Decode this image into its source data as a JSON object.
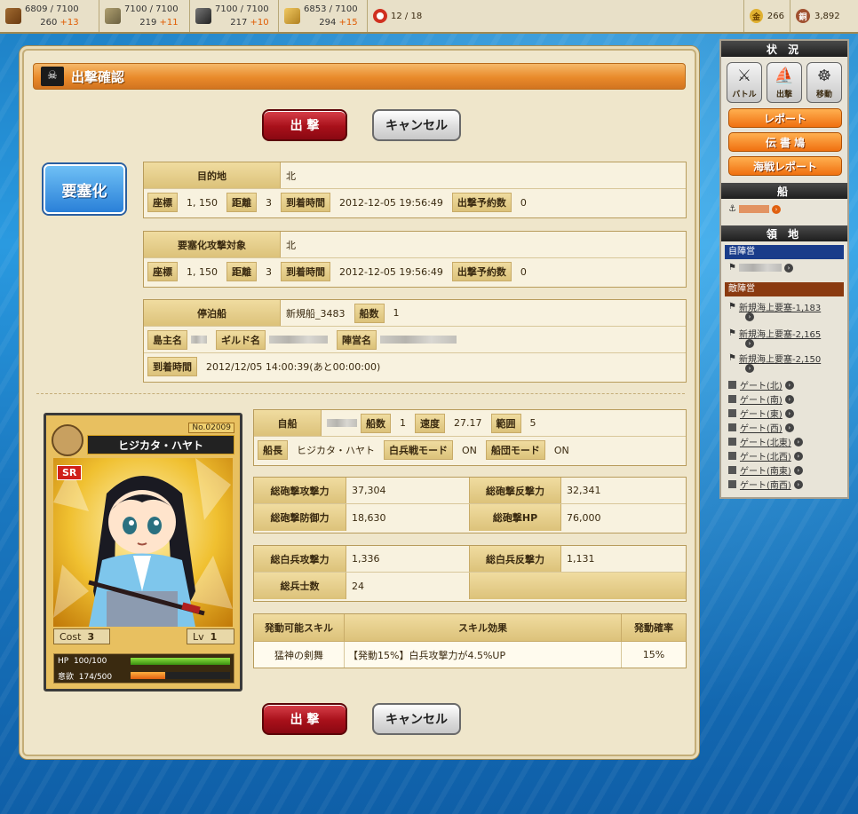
{
  "resources": [
    {
      "icon": "wood-icon",
      "color": "#8a5a2a",
      "amount": "6809 / 7100",
      "rate": "260",
      "inc": "+13"
    },
    {
      "icon": "cloth-icon",
      "color": "#7a7a4a",
      "amount": "7100 / 7100",
      "rate": "219",
      "inc": "+11"
    },
    {
      "icon": "iron-icon",
      "color": "#4a4a4a",
      "amount": "7100 / 7100",
      "rate": "217",
      "inc": "+10"
    },
    {
      "icon": "grain-icon",
      "color": "#d0a040",
      "amount": "6853 / 7100",
      "rate": "294",
      "inc": "+15"
    }
  ],
  "crew": "12 / 18",
  "gold": {
    "label": "金",
    "value": "266"
  },
  "copper": {
    "label": "銅",
    "value": "3,892"
  },
  "panel": {
    "title": "出撃確認",
    "sortie": "出 撃",
    "cancel": "キャンセル",
    "fortify": "要塞化"
  },
  "dest": {
    "label": "目的地",
    "value": "北",
    "coord_label": "座標",
    "coord": "1, 150",
    "dist_label": "距離",
    "dist": "3",
    "arrival_label": "到着時間",
    "arrival": "2012-12-05 19:56:49",
    "reserve_label": "出撃予約数",
    "reserve": "0"
  },
  "target": {
    "label": "要塞化攻撃対象",
    "value": "北",
    "coord_label": "座標",
    "coord": "1, 150",
    "dist_label": "距離",
    "dist": "3",
    "arrival_label": "到着時間",
    "arrival": "2012-12-05 19:56:49",
    "reserve_label": "出撃予約数",
    "reserve": "0"
  },
  "port": {
    "label": "停泊船",
    "value": "新規船_3483",
    "ships_label": "船数",
    "ships": "1",
    "owner_label": "島主名",
    "guild_label": "ギルド名",
    "camp_label": "陣営名",
    "arrival_label": "到着時間",
    "arrival": "2012/12/05 14:00:39(あと00:00:00)"
  },
  "card": {
    "no": "No.02009",
    "name": "ヒジカタ・ハヤト",
    "rarity": "SR",
    "cost_label": "Cost",
    "cost": "3",
    "lv_label": "Lv",
    "lv": "1",
    "hp_label": "HP",
    "hp": "100/100",
    "hp_pct": 100,
    "morale_label": "意欲",
    "morale": "174/500",
    "morale_pct": 34.8
  },
  "ship": {
    "label": "自船",
    "ships_label": "船数",
    "ships": "1",
    "speed_label": "速度",
    "speed": "27.17",
    "range_label": "範囲",
    "range": "5",
    "captain_label": "船長",
    "captain": "ヒジカタ・ハヤト",
    "melee_label": "白兵戦モード",
    "melee": "ON",
    "fleet_label": "船団モード",
    "fleet": "ON"
  },
  "cannon": {
    "atk_label": "総砲撃攻撃力",
    "atk": "37,304",
    "cnt_label": "総砲撃反撃力",
    "cnt": "32,341",
    "def_label": "総砲撃防御力",
    "def": "18,630",
    "hp_label": "総砲撃HP",
    "hp": "76,000"
  },
  "melee": {
    "atk_label": "総白兵攻撃力",
    "atk": "1,336",
    "cnt_label": "総白兵反撃力",
    "cnt": "1,131",
    "sol_label": "総兵士数",
    "sol": "24"
  },
  "skill": {
    "h1": "発動可能スキル",
    "h2": "スキル効果",
    "h3": "発動確率",
    "name": "猛神の剣舞",
    "effect": "【発動15%】白兵攻撃力が4.5%UP",
    "rate": "15%"
  },
  "side": {
    "status": "状 況",
    "battle": "バトル",
    "sortie": "出撃",
    "move": "移動",
    "report": "レポート",
    "pigeon": "伝 書 鳩",
    "naval": "海戦レポート",
    "ship": "船",
    "territory": "領 地",
    "own": "自陣営",
    "enemy": "敵陣営",
    "enemy_items": [
      "新規海上要塞-1,183",
      "新規海上要塞-2,165",
      "新規海上要塞-2,150"
    ],
    "gates": [
      "ゲート(北)",
      "ゲート(南)",
      "ゲート(東)",
      "ゲート(西)",
      "ゲート(北東)",
      "ゲート(北西)",
      "ゲート(南東)",
      "ゲート(南西)"
    ]
  }
}
